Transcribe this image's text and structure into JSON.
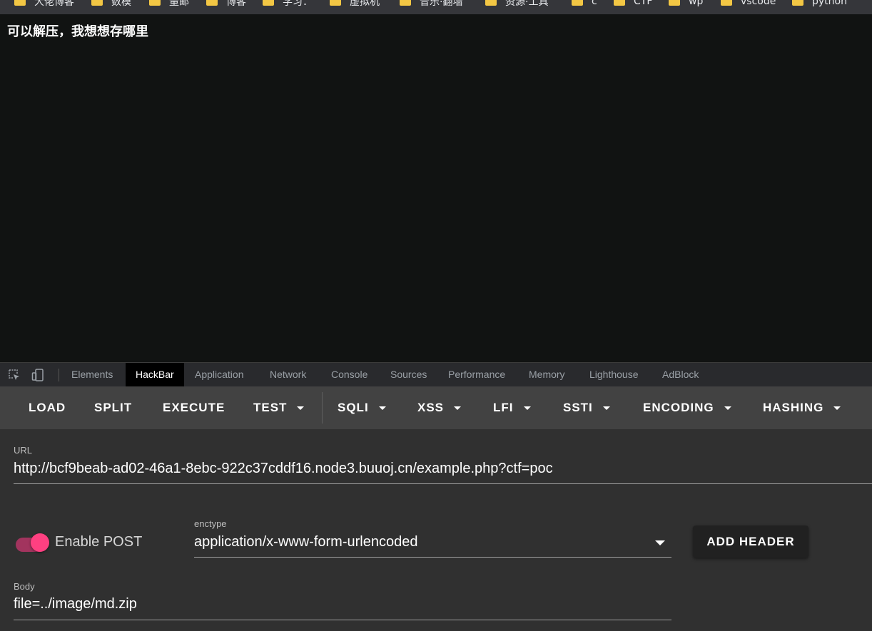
{
  "bookmarks": [
    {
      "label": "大佬博客"
    },
    {
      "label": "数模"
    },
    {
      "label": "量邮"
    },
    {
      "label": "博客"
    },
    {
      "label": "学习："
    },
    {
      "label": "虚拟机"
    },
    {
      "label": "音乐·翻墙"
    },
    {
      "label": "资源·工具"
    },
    {
      "label": "c"
    },
    {
      "label": "CTF"
    },
    {
      "label": "wp"
    },
    {
      "label": "vscode"
    },
    {
      "label": "python"
    }
  ],
  "page": {
    "message": "可以解压，我想想存哪里"
  },
  "devtools": {
    "tabs": [
      "Elements",
      "HackBar",
      "Application",
      "Network",
      "Console",
      "Sources",
      "Performance",
      "Memory",
      "Lighthouse",
      "AdBlock"
    ],
    "active_tab": "HackBar"
  },
  "hackbar": {
    "toolbar": {
      "load": "LOAD",
      "split": "SPLIT",
      "execute": "EXECUTE",
      "test": "TEST",
      "sqli": "SQLI",
      "xss": "XSS",
      "lfi": "LFI",
      "ssti": "SSTI",
      "encoding": "ENCODING",
      "hashing": "HASHING"
    },
    "url_label": "URL",
    "url_value": "http://bcf9beab-ad02-46a1-8ebc-922c37cddf16.node3.buuoj.cn/example.php?ctf=poc",
    "enable_post_label": "Enable POST",
    "enable_post": true,
    "enctype_label": "enctype",
    "enctype_value": "application/x-www-form-urlencoded",
    "add_header_label": "ADD HEADER",
    "body_label": "Body",
    "body_value": "file=../image/md.zip",
    "accent_color": "#ff4081"
  }
}
